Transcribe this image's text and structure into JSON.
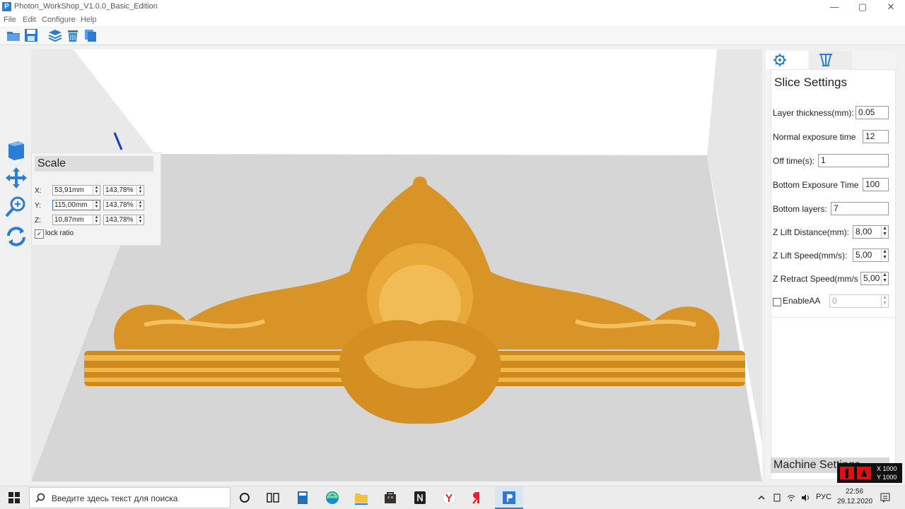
{
  "window": {
    "title": "Photon_WorkShop_V1.0.0_Basic_Edition",
    "app_icon": "P",
    "min": "—",
    "max": "▢",
    "close": "✕"
  },
  "menu": [
    "File",
    "Edit",
    "Configure",
    "Help"
  ],
  "toolbar": {
    "icons": [
      "open-folder-icon",
      "save-icon",
      "slice-layers-icon",
      "trash-icon",
      "copy-icon"
    ]
  },
  "left_tools": {
    "icons": [
      "cube-view-icon",
      "move-icon",
      "zoom-scale-icon",
      "rotate-icon"
    ]
  },
  "scale": {
    "title": "Scale",
    "rows": [
      {
        "axis": "X:",
        "mm": "53,91mm",
        "pct": "143,78%"
      },
      {
        "axis": "Y:",
        "mm": "115,00mm",
        "pct": "143,78%"
      },
      {
        "axis": "Z:",
        "mm": "10,87mm",
        "pct": "143,78%"
      }
    ],
    "lock_ratio": "lock ratio"
  },
  "right_panel": {
    "tabs": [
      "gear-icon",
      "support-icon"
    ],
    "slice_title": "Slice Settings",
    "rows": [
      {
        "label": "Layer thickness(mm):",
        "value": "0.05"
      },
      {
        "label": "Normal exposure time",
        "value": "12"
      },
      {
        "label": "Off time(s):",
        "value": "1"
      },
      {
        "label": "Bottom Exposure Time",
        "value": "100"
      },
      {
        "label": "Bottom layers:",
        "value": "7"
      },
      {
        "label": "Z Lift Distance(mm):",
        "value": "8,00"
      },
      {
        "label": "Z Lift Speed(mm/s):",
        "value": "5,00"
      },
      {
        "label": "Z Retract Speed(mm/s",
        "value": "5,00"
      }
    ],
    "enable_aa": {
      "label": "EnableAA",
      "value": "0"
    },
    "machine_title": "Machine Settings"
  },
  "overlay": {
    "x": "X 1000",
    "y": "Y 1000"
  },
  "taskbar": {
    "search_placeholder": "Введите здесь текст для поиска",
    "lang": "РУС",
    "time": "22:56",
    "date": "29.12.2020"
  },
  "colors": {
    "model": "#e0a030",
    "accent": "#2b7cd3"
  }
}
